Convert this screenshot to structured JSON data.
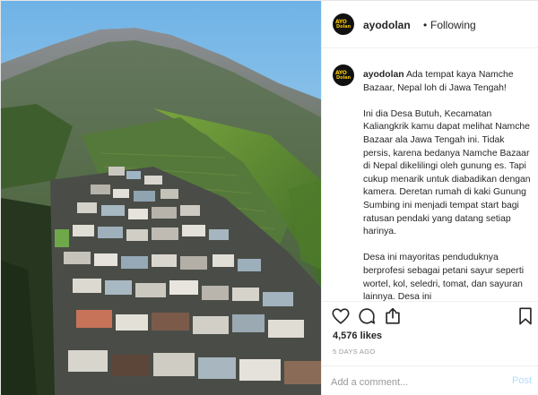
{
  "account": {
    "username": "ayodolan",
    "avatar_text_top": "AYO",
    "avatar_text_bottom": "Dolan"
  },
  "header": {
    "separator": "•",
    "follow_status": "Following"
  },
  "caption": {
    "username": "ayodolan",
    "paragraphs": [
      "Ada tempat kaya Namche Bazaar, Nepal loh di Jawa Tengah!",
      "Ini dia Desa Butuh, Kecamatan Kaliangkrik kamu dapat melihat Namche Bazaar ala Jawa Tengah ini. Tidak persis, karena bedanya Namche Bazaar di Nepal dikelilingi oleh gunung es. Tapi cukup menarik untuk diabadikan dengan kamera. Deretan rumah di kaki Gunung Sumbing ini menjadi tempat start bagi ratusan pendaki yang datang setiap harinya.",
      "Desa ini mayoritas penduduknya berprofesi sebagai petani sayur seperti wortel, kol, seledri, tomat, dan sayuran lainnya. Desa ini"
    ]
  },
  "actions": {
    "like_icon": "heart-icon",
    "comment_icon": "comment-icon",
    "share_icon": "share-icon",
    "save_icon": "bookmark-icon"
  },
  "stats": {
    "likes": "4,576 likes",
    "date": "5 DAYS AGO"
  },
  "comment": {
    "placeholder": "Add a comment...",
    "post_label": "Post"
  },
  "colors": {
    "post_disabled": "#b3dbff",
    "meta_gray": "#999999",
    "text": "#262626",
    "avatar_yellow": "#f2c500"
  }
}
